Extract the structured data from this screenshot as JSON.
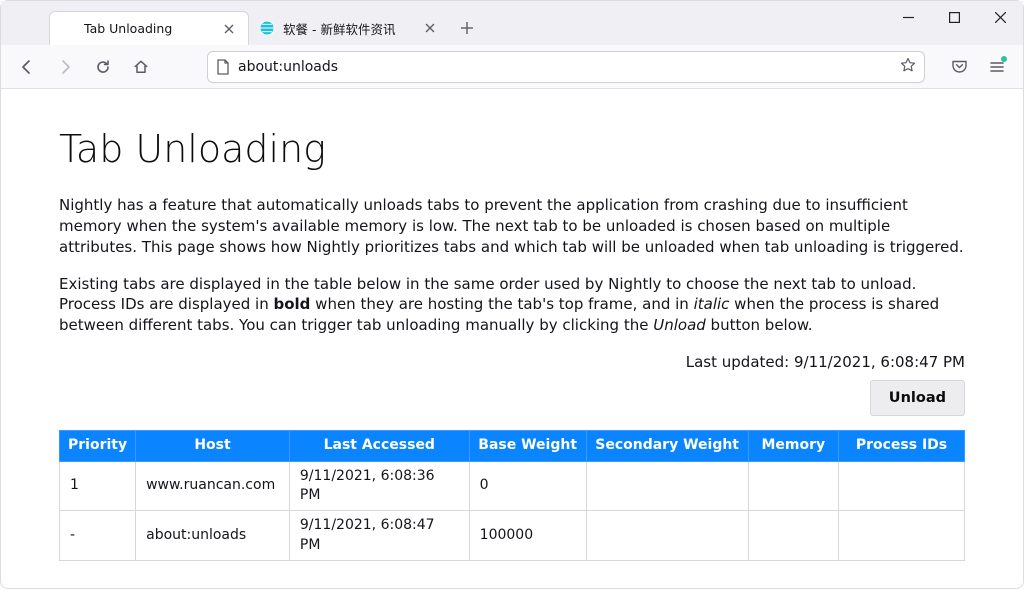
{
  "tabs": {
    "items": [
      {
        "title": "Tab Unloading",
        "active": true,
        "favicon": "none"
      },
      {
        "title": "软餐 - 新鲜软件资讯",
        "active": false,
        "favicon": "globe-teal"
      }
    ]
  },
  "urlbar": {
    "url": "about:unloads"
  },
  "page": {
    "heading": "Tab Unloading",
    "para1": "Nightly has a feature that automatically unloads tabs to prevent the application from crashing due to insufficient memory when the system's available memory is low. The next tab to be unloaded is chosen based on multiple attributes. This page shows how Nightly prioritizes tabs and which tab will be unloaded when tab unloading is triggered.",
    "para2_a": "Existing tabs are displayed in the table below in the same order used by Nightly to choose the next tab to unload. Process IDs are displayed in ",
    "para2_bold": "bold",
    "para2_b": " when they are hosting the tab's top frame, and in ",
    "para2_italic": "italic",
    "para2_c": " when the process is shared between different tabs. You can trigger tab unloading manually by clicking the ",
    "para2_unload_italic": "Unload",
    "para2_d": " button below.",
    "last_updated_label": "Last updated: ",
    "last_updated_value": "9/11/2021, 6:08:47 PM",
    "unload_button": "Unload"
  },
  "table": {
    "headers": {
      "priority": "Priority",
      "host": "Host",
      "last_accessed": "Last Accessed",
      "base_weight": "Base Weight",
      "secondary_weight": "Secondary Weight",
      "memory": "Memory",
      "process_ids": "Process IDs"
    },
    "rows": [
      {
        "priority": "1",
        "host": "www.ruancan.com",
        "last_accessed": "9/11/2021, 6:08:36 PM",
        "base_weight": "0",
        "secondary_weight": "",
        "memory": "",
        "process_ids": ""
      },
      {
        "priority": "-",
        "host": "about:unloads",
        "last_accessed": "9/11/2021, 6:08:47 PM",
        "base_weight": "100000",
        "secondary_weight": "",
        "memory": "",
        "process_ids": ""
      }
    ]
  }
}
